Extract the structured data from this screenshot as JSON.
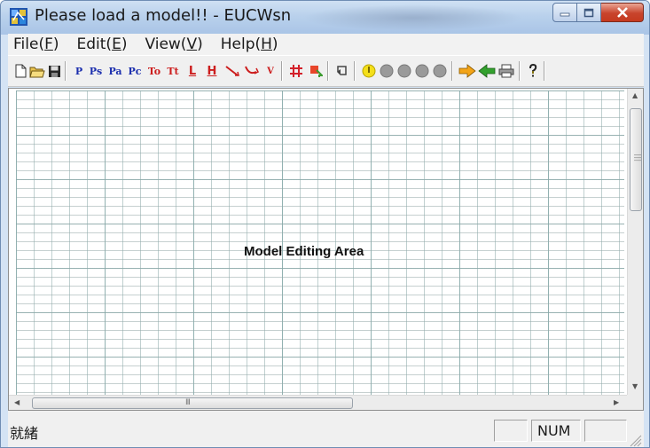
{
  "window": {
    "title": "Please load a model!! - EUCWsn"
  },
  "menu": {
    "items": [
      {
        "label": "File(",
        "key": "F",
        "tail": ")"
      },
      {
        "label": "Edit(",
        "key": "E",
        "tail": ")"
      },
      {
        "label": "View(",
        "key": "V",
        "tail": ")"
      },
      {
        "label": "Help(",
        "key": "H",
        "tail": ")"
      }
    ]
  },
  "toolbar": {
    "new_icon": "new-document-icon",
    "open_icon": "open-folder-icon",
    "save_icon": "floppy-disk-icon",
    "p": "P",
    "ps": "Ps",
    "pa": "Pa",
    "pc": "Pc",
    "to": "To",
    "tt": "Tt",
    "l": "L",
    "h": "H",
    "v": "V",
    "print_icon": "printer-icon",
    "help_icon": "help-question-icon",
    "colors": {
      "blue_text": "#1c2fae",
      "red_text": "#cc1d1d",
      "yellow": "#f4df1a",
      "grey": "#9a9a9a",
      "orange_arrow": "#f3a417",
      "green_arrow": "#33a12e"
    }
  },
  "canvas": {
    "label": "Model Editing Area",
    "scroll_grip": "III"
  },
  "status": {
    "text": "就緒",
    "num": "NUM"
  }
}
